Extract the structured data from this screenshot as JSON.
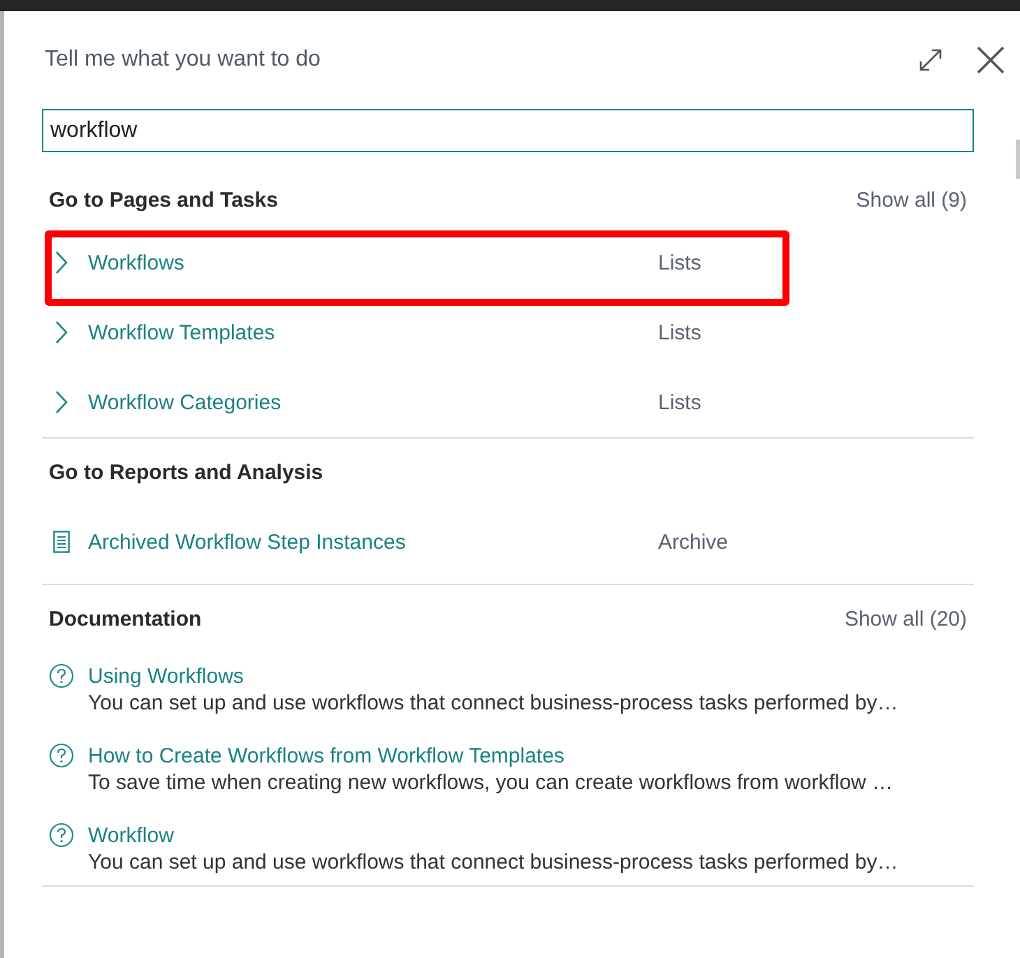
{
  "dialog": {
    "title": "Tell me what you want to do"
  },
  "search": {
    "value": "workflow"
  },
  "sections": [
    {
      "heading": "Go to Pages and Tasks",
      "show_all": "Show all (9)",
      "items": [
        {
          "kind": "page",
          "label": "Workflows",
          "category": "Lists",
          "highlighted": true
        },
        {
          "kind": "page",
          "label": "Workflow Templates",
          "category": "Lists",
          "highlighted": false
        },
        {
          "kind": "page",
          "label": "Workflow Categories",
          "category": "Lists",
          "highlighted": false
        }
      ]
    },
    {
      "heading": "Go to Reports and Analysis",
      "items": [
        {
          "kind": "report",
          "label": "Archived Workflow Step Instances",
          "category": "Archive",
          "highlighted": false
        }
      ]
    },
    {
      "heading": "Documentation",
      "show_all": "Show all (20)",
      "items": [
        {
          "kind": "help",
          "label": "Using Workflows",
          "description": "You can set up and use workflows that connect business-process tasks performed by…",
          "highlighted": false
        },
        {
          "kind": "help",
          "label": "How to Create Workflows from Workflow Templates",
          "description": "To save time when creating new workflows, you can create workflows from workflow …",
          "highlighted": false
        },
        {
          "kind": "help",
          "label": "Workflow",
          "description": "You can set up and use workflows that connect business-process tasks performed by…",
          "highlighted": false
        }
      ]
    }
  ]
}
